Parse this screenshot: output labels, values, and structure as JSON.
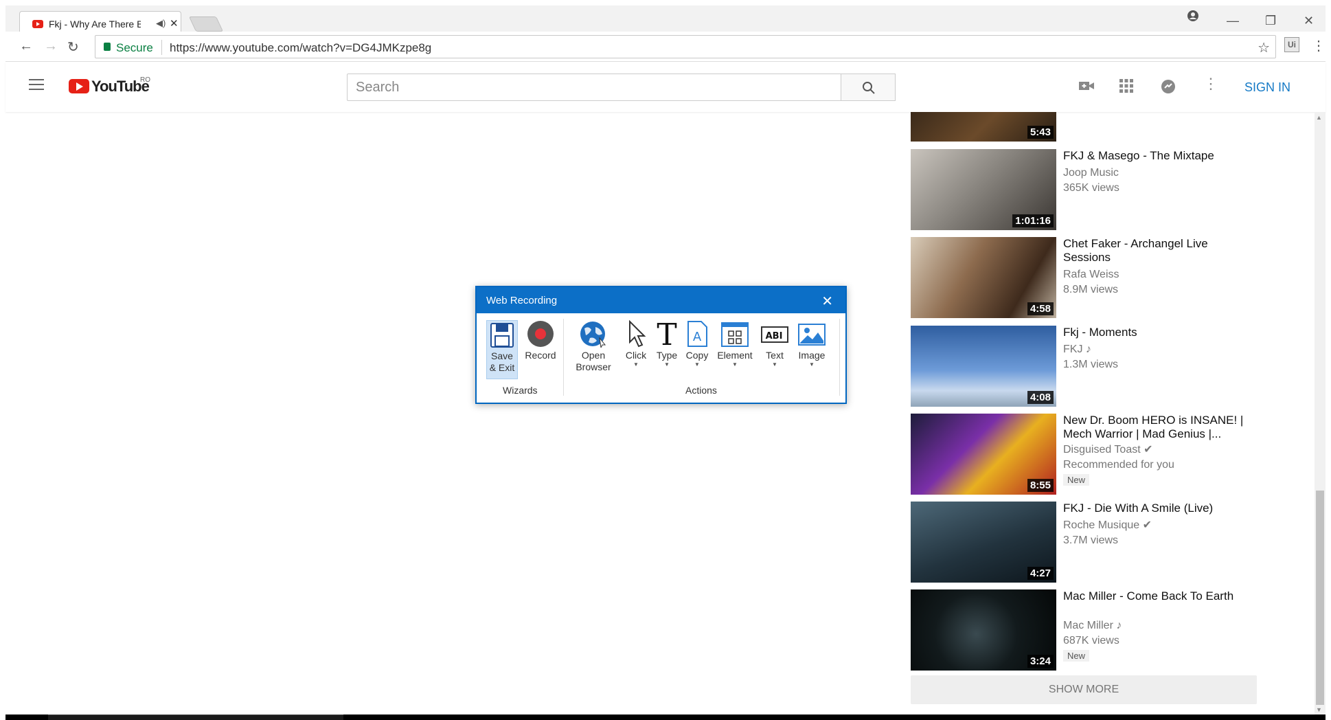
{
  "browser": {
    "tab_title": "Fkj - Why Are There B",
    "tab_audio_icon": "speaker-icon",
    "secure_label": "Secure",
    "url": "https://www.youtube.com/watch?v=DG4JMKzpe8g",
    "extension_label": "Ui"
  },
  "youtube": {
    "logo_text": "YouTube",
    "region": "RO",
    "search_placeholder": "Search",
    "sign_in": "SIGN IN",
    "accent_color": "#e62117",
    "link_color": "#167ac6"
  },
  "sidebar": {
    "videos": [
      {
        "title": "",
        "channel": "",
        "views": "",
        "duration": "5:43"
      },
      {
        "title": "FKJ & Masego - The Mixtape",
        "channel": "Joop Music",
        "views": "365K views",
        "duration": "1:01:16"
      },
      {
        "title": "Chet Faker - Archangel Live Sessions",
        "channel": "Rafa Weiss",
        "views": "8.9M views",
        "duration": "4:58"
      },
      {
        "title": "Fkj - Moments",
        "channel": "FKJ ♪",
        "views": "1.3M views",
        "duration": "4:08"
      },
      {
        "title": "New Dr. Boom HERO is INSANE! | Mech Warrior | Mad Genius |...",
        "channel": "Disguised Toast ✔",
        "views": "Recommended for you",
        "badge": "New",
        "duration": "8:55"
      },
      {
        "title": "FKJ - Die With A Smile (Live)",
        "channel": "Roche Musique ✔",
        "views": "3.7M views",
        "duration": "4:27"
      },
      {
        "title": "Mac Miller - Come Back To Earth",
        "channel": "Mac Miller ♪",
        "views": "687K views",
        "badge": "New",
        "duration": "3:24"
      }
    ],
    "show_more": "SHOW MORE"
  },
  "dialog": {
    "title": "Web Recording",
    "wizards_group": "Wizards",
    "actions_group": "Actions",
    "tools": {
      "save_1": "Save",
      "save_2": "& Exit",
      "record": "Record",
      "open_1": "Open",
      "open_2": "Browser",
      "click": "Click",
      "type": "Type",
      "copy": "Copy",
      "element": "Element",
      "text": "Text",
      "image": "Image"
    }
  }
}
